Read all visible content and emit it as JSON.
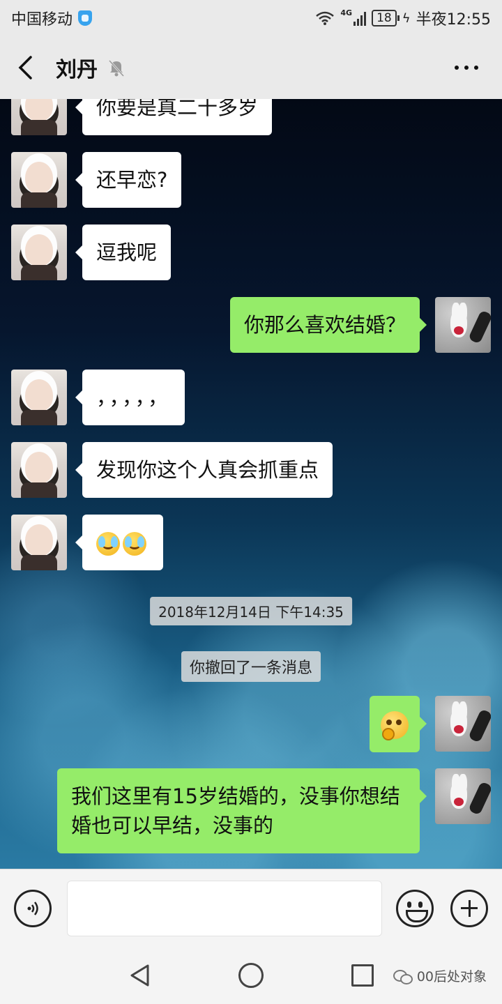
{
  "status_bar": {
    "carrier": "中国移动",
    "network": "4G",
    "battery": "18",
    "time": "半夜12:55"
  },
  "header": {
    "contact_name": "刘丹",
    "icons": [
      "back-arrow-icon",
      "bell-muted-icon",
      "more-icon"
    ]
  },
  "messages": [
    {
      "side": "in",
      "text": "你要是真二十多岁"
    },
    {
      "side": "in",
      "text": "还早恋?"
    },
    {
      "side": "in",
      "text": "逗我呢"
    },
    {
      "side": "out",
      "text": "你那么喜欢结婚？"
    },
    {
      "side": "in",
      "text": "，，，，，"
    },
    {
      "side": "in",
      "text": "发现你这个人真会抓重点"
    },
    {
      "side": "in",
      "emoji": "crying-face-emoji x2"
    },
    {
      "side": "out",
      "emoji": "thinking-face-emoji"
    },
    {
      "side": "out",
      "text": "我们这里有15岁结婚的，没事你想结婚也可以早结，没事的"
    }
  ],
  "system": {
    "timestamp": "2018年12月14日 下午14:35",
    "recall_notice": "你撤回了一条消息"
  },
  "input_bar": {
    "placeholder": "",
    "icons": [
      "voice-icon",
      "emoji-icon",
      "plus-icon"
    ]
  },
  "nav_bar": {
    "watermark": "00后处对象",
    "icons": [
      "nav-back-icon",
      "nav-home-icon",
      "nav-recent-icon"
    ]
  },
  "colors": {
    "incoming_bubble": "#ffffff",
    "outgoing_bubble": "#95ec69",
    "bar_background": "#eaeaea"
  }
}
